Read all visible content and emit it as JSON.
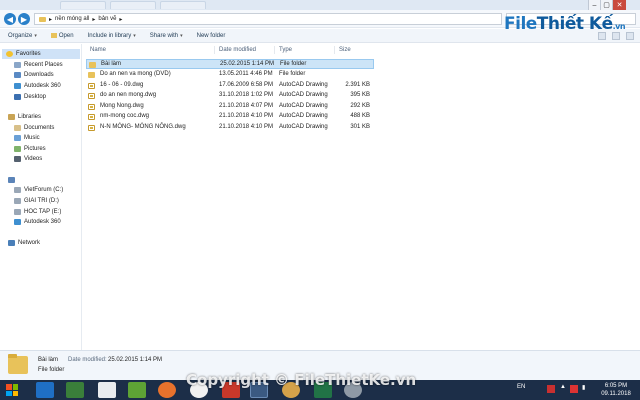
{
  "address": {
    "path": [
      "nền móng all",
      "bản vẽ"
    ]
  },
  "toolbar": {
    "organize": "Organize",
    "open": "Open",
    "include": "Include in library",
    "share": "Share with",
    "new_folder": "New folder"
  },
  "sidebar": {
    "favorites": "Favorites",
    "recent_places": "Recent Places",
    "downloads": "Downloads",
    "autodesk": "Autodesk 360",
    "desktop": "Desktop",
    "libraries": "Libraries",
    "documents": "Documents",
    "music": "Music",
    "pictures": "Pictures",
    "videos": "Videos",
    "drive_c": "VietForum (C:)",
    "drive_d": "GIAI TRI (D:)",
    "drive_e": "HOC TAP (E:)",
    "autodesk2": "Autodesk 360",
    "network": "Network"
  },
  "columns": {
    "name": "Name",
    "date": "Date modified",
    "type": "Type",
    "size": "Size"
  },
  "files": [
    {
      "name": "Bài làm",
      "date": "25.02.2015 1:14 PM",
      "type": "File folder",
      "size": "",
      "kind": "folder"
    },
    {
      "name": "Do an nen va mong (DVD)",
      "date": "13.05.2011 4:46 PM",
      "type": "File folder",
      "size": "",
      "kind": "folder"
    },
    {
      "name": "16 - 06 - 09.dwg",
      "date": "17.06.2009 6:58 PM",
      "type": "AutoCAD Drawing",
      "size": "2.391 KB",
      "kind": "dwg"
    },
    {
      "name": "do an nen mong.dwg",
      "date": "31.10.2018 1:02 PM",
      "type": "AutoCAD Drawing",
      "size": "395 KB",
      "kind": "dwg"
    },
    {
      "name": "Mong Nong.dwg",
      "date": "21.10.2018 4:07 PM",
      "type": "AutoCAD Drawing",
      "size": "292 KB",
      "kind": "dwg"
    },
    {
      "name": "nm-mong coc.dwg",
      "date": "21.10.2018 4:10 PM",
      "type": "AutoCAD Drawing",
      "size": "488 KB",
      "kind": "dwg"
    },
    {
      "name": "N-N MÓNG- MÓNG NÔNG.dwg",
      "date": "21.10.2018 4:10 PM",
      "type": "AutoCAD Drawing",
      "size": "301 KB",
      "kind": "dwg"
    }
  ],
  "details": {
    "name": "Bài làm",
    "label": "Date modified:",
    "value": "25.02.2015 1:14 PM",
    "type": "File folder"
  },
  "brand": {
    "part1": "File",
    "part2": "Thiết Kế",
    "part3": ".vn"
  },
  "watermark": "Copyright © FileThietKe.vn",
  "taskbar": {
    "lang": "EN",
    "time": "6:05 PM",
    "date": "09.11.2018"
  },
  "colors": {
    "accent": "#2a80c9",
    "selection": "#cce4f7",
    "taskbar": "#1c2e48",
    "folder": "#e8c25a"
  }
}
